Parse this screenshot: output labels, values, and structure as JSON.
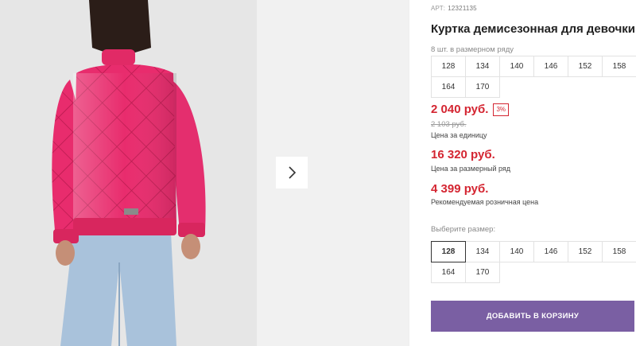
{
  "product": {
    "sku_label": "АРТ:",
    "sku_value": "12321135",
    "title": "Куртка демисезонная для девочки",
    "pack_note": "8 шт. в размерном ряду",
    "pack_sizes": [
      "128",
      "134",
      "140",
      "146",
      "152",
      "158",
      "164",
      "170"
    ]
  },
  "pricing": {
    "price": "2 040 руб.",
    "discount": "3%",
    "old_price": "2 103 руб.",
    "unit_label": "Цена за единицу",
    "pack_price": "16 320 руб.",
    "pack_label": "Цена за размерный ряд",
    "retail_price": "4 399 руб.",
    "retail_label": "Рекомендуемая розничная цена"
  },
  "size_picker": {
    "label": "Выберите размер:",
    "selected": "128",
    "sizes": [
      "128",
      "134",
      "140",
      "146",
      "152",
      "158",
      "164",
      "170"
    ]
  },
  "cart": {
    "button_label": "ДОБАВИТЬ В КОРЗИНУ"
  },
  "colors": {
    "accent": "#7a5fa3",
    "price": "#d42531",
    "jacket": "#ea2e6f",
    "jeans": "#a9c2db"
  }
}
